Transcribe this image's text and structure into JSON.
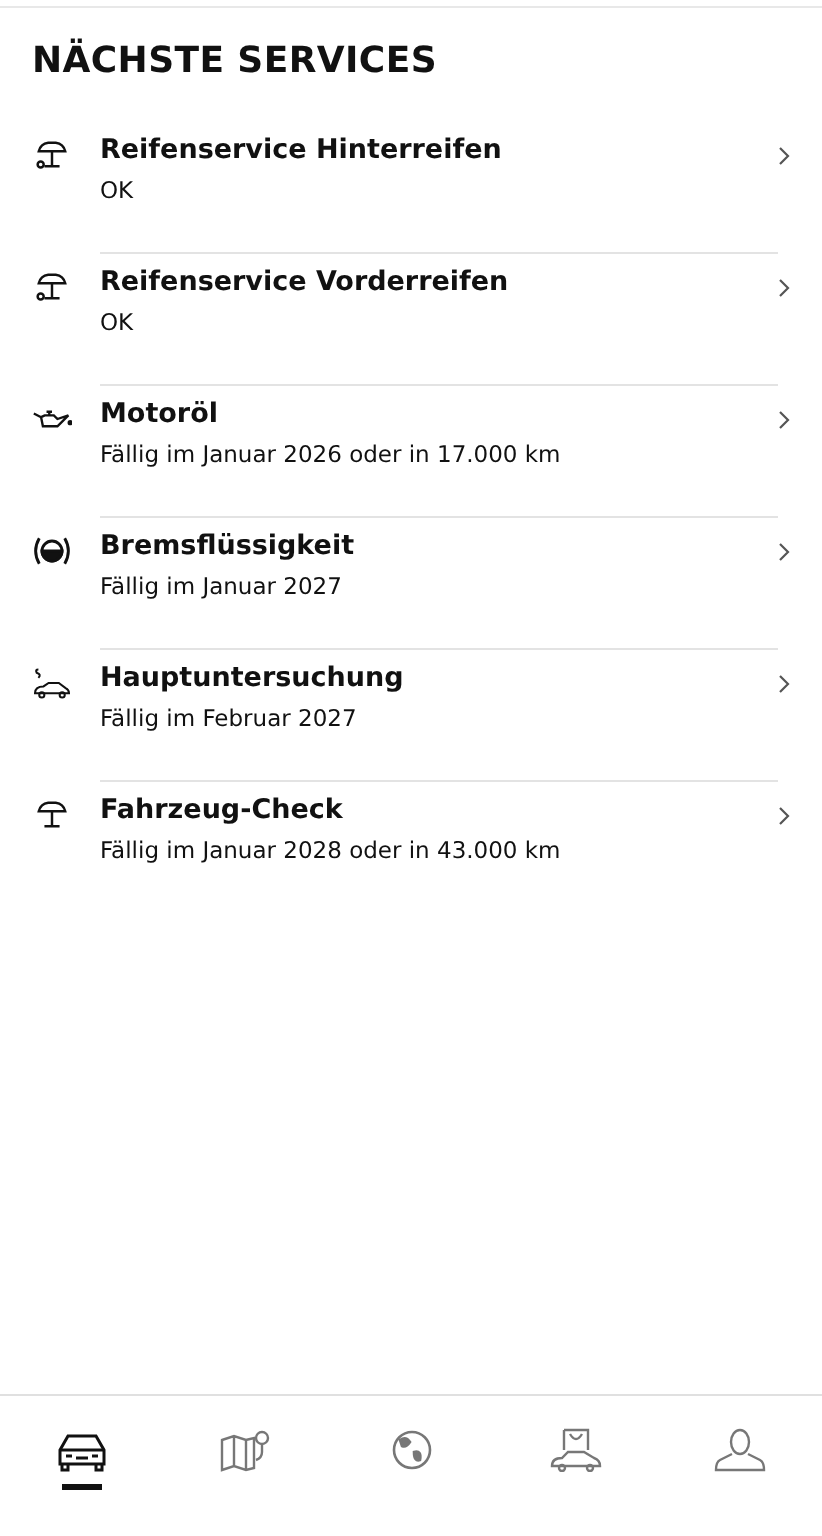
{
  "title": "NÄCHSTE SERVICES",
  "services": [
    {
      "kind": "tire",
      "name": "Reifenservice Hinterreifen",
      "status": "OK"
    },
    {
      "kind": "tire",
      "name": "Reifenservice Vorderreifen",
      "status": "OK"
    },
    {
      "kind": "oil",
      "name": "Motoröl",
      "status": "Fällig im Januar 2026 oder in 17.000 km"
    },
    {
      "kind": "brake",
      "name": "Bremsflüssigkeit",
      "status": "Fällig im Januar 2027"
    },
    {
      "kind": "inspection",
      "name": "Hauptuntersuchung",
      "status": "Fällig im Februar 2027"
    },
    {
      "kind": "lift",
      "name": "Fahrzeug-Check",
      "status": "Fällig im Januar 2028 oder in 43.000 km"
    }
  ],
  "nav": [
    {
      "kind": "car",
      "selected": true
    },
    {
      "kind": "map",
      "selected": false
    },
    {
      "kind": "globe",
      "selected": false
    },
    {
      "kind": "shop",
      "selected": false
    },
    {
      "kind": "profile",
      "selected": false
    }
  ]
}
